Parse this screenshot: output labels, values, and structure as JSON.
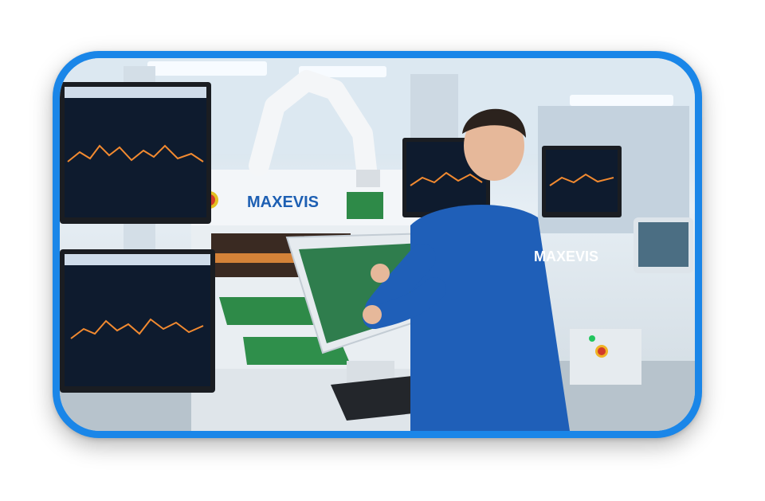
{
  "scene": {
    "machine_brand": "MAXEVIS",
    "jacket_brand": "MAXEVIS"
  },
  "colors": {
    "frame": "#1a86e8",
    "jacket": "#1f5fb8",
    "machine": "#e9eef2",
    "pcb": "#2e8a48",
    "chart_line": "#f28a30"
  }
}
